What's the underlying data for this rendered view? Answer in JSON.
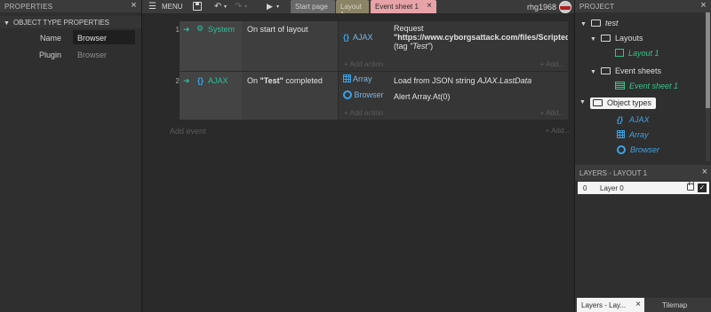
{
  "properties": {
    "title": "PROPERTIES",
    "section": "OBJECT TYPE PROPERTIES",
    "rows": [
      {
        "label": "Name",
        "value": "Browser"
      },
      {
        "label": "Plugin",
        "value": "Browser"
      }
    ]
  },
  "toolbar": {
    "menu_label": "MENU",
    "tabs": [
      "Start page",
      "Layout 1",
      "Event sheet 1"
    ],
    "user": "rhg1968"
  },
  "events": [
    {
      "number": "1",
      "object": "System",
      "condition": "On start of layout",
      "actions": [
        {
          "object": "AJAX",
          "line1": "Request",
          "line2": "\"https://www.cyborgsattack.com/files/ScriptedCo",
          "line3_prefix": "(tag ",
          "line3_tag": "\"Test\"",
          "line3_suffix": ")"
        }
      ],
      "add_action": "+ Add action",
      "add_more": "+ Add..."
    },
    {
      "number": "2",
      "object": "AJAX",
      "condition_prefix": "On ",
      "condition_bold": "\"Test\"",
      "condition_suffix": " completed",
      "actions": [
        {
          "object": "Array",
          "text_prefix": "Load from JSON string ",
          "text_italic": "AJAX.LastData"
        },
        {
          "object": "Browser",
          "text": "Alert Array.At(0)"
        }
      ],
      "add_action": "+ Add action",
      "add_more": "+ Add..."
    }
  ],
  "add_event": "Add event",
  "add_event_more": "+ Add...",
  "project": {
    "title": "PROJECT",
    "root": "test",
    "layouts_folder": "Layouts",
    "layout_item": "Layout 1",
    "sheets_folder": "Event sheets",
    "sheet_item": "Event sheet 1",
    "objects_folder": "Object types",
    "objects": [
      "AJAX",
      "Array",
      "Browser"
    ]
  },
  "layers": {
    "title": "LAYERS - LAYOUT 1",
    "rows": [
      {
        "index": "0",
        "name": "Layer 0"
      }
    ]
  },
  "bottom_tabs": [
    "Layers - Lay...",
    "Tilemap"
  ],
  "colors": {
    "accent_green": "#35c38a",
    "accent_blue": "#3ba3e8",
    "tab_active": "#e7a3a8"
  }
}
